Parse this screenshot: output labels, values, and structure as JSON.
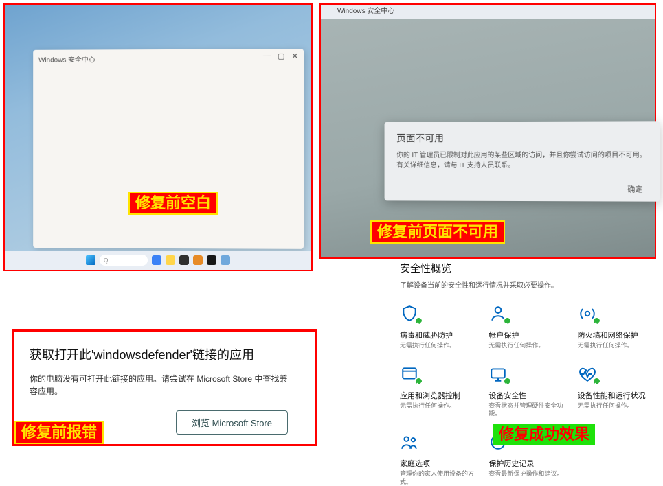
{
  "panel1": {
    "window_title": "Windows 安全中心",
    "search_placeholder": "搜索",
    "caption": "修复前空白"
  },
  "panel2": {
    "window_title": "Windows 安全中心",
    "dialog_title": "页面不可用",
    "dialog_body": "你的 IT 管理员已限制对此应用的某些区域的访问，并且你尝试访问的项目不可用。有关详细信息，请与 IT 支持人员联系。",
    "ok_label": "确定",
    "caption": "修复前页面不可用"
  },
  "panel3": {
    "heading": "获取打开此'windowsdefender'链接的应用",
    "body": "你的电脑没有可打开此链接的应用。请尝试在 Microsoft Store 中查找兼容应用。",
    "browse_label": "浏览 Microsoft Store",
    "caption": "修复前报错"
  },
  "panel4": {
    "heading": "安全性概览",
    "sub": "了解设备当前的安全性和运行情况并采取必要操作。",
    "tiles": [
      {
        "title": "病毒和威胁防护",
        "desc": "无需执行任何操作。"
      },
      {
        "title": "帐户保护",
        "desc": "无需执行任何操作。"
      },
      {
        "title": "防火墙和网络保护",
        "desc": "无需执行任何操作。"
      },
      {
        "title": "应用和浏览器控制",
        "desc": "无需执行任何操作。"
      },
      {
        "title": "设备安全性",
        "desc": "查看状态并管理硬件安全功能。"
      },
      {
        "title": "设备性能和运行状况",
        "desc": "无需执行任何操作。"
      },
      {
        "title": "家庭选项",
        "desc": "管理你的家人使用设备的方式。"
      },
      {
        "title": "保护历史记录",
        "desc": "查看最新保护操作和建议。"
      }
    ],
    "caption": "修复成功效果"
  }
}
